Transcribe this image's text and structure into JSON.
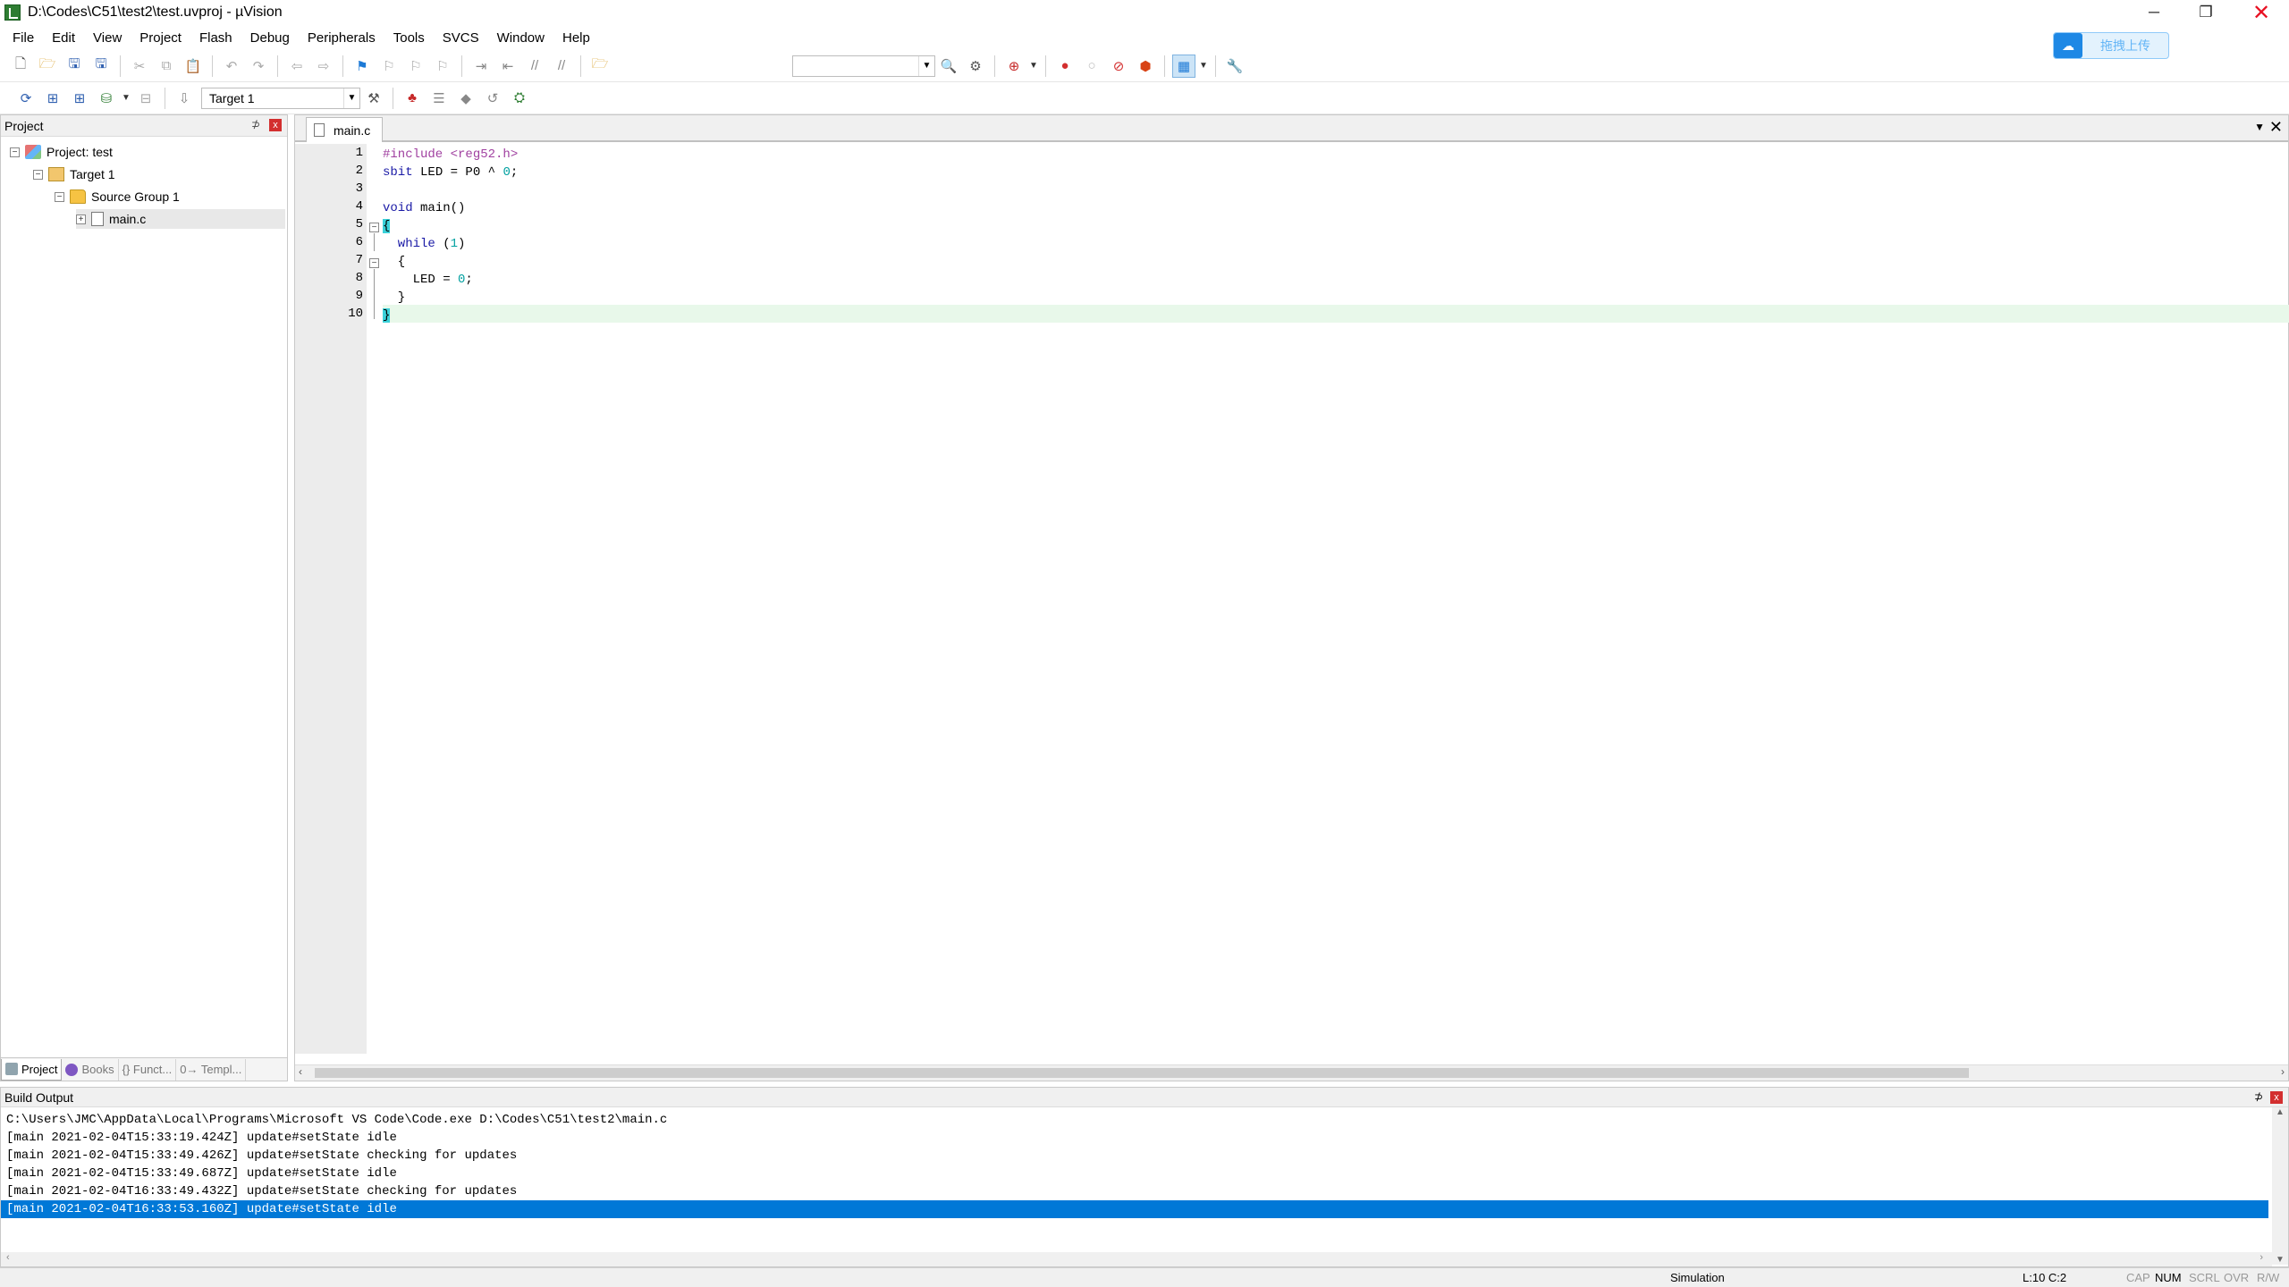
{
  "window": {
    "title": "D:\\Codes\\C51\\test2\\test.uvproj - µVision",
    "minimize_glyph": "─",
    "restore_glyph": "❐",
    "close_glyph": "✕"
  },
  "cloud_widget": {
    "label": "拖拽上传",
    "icon": "cloud-icon"
  },
  "menu": [
    "File",
    "Edit",
    "View",
    "Project",
    "Flash",
    "Debug",
    "Peripherals",
    "Tools",
    "SVCS",
    "Window",
    "Help"
  ],
  "toolbar2": {
    "target_label": "Target 1"
  },
  "project_panel": {
    "header": "Project",
    "pin": "⊅",
    "close": "x",
    "tree": {
      "project": "Project: test",
      "target": "Target 1",
      "group": "Source Group 1",
      "file": "main.c"
    },
    "tabs": [
      "Project",
      "Books",
      "{} Funct...",
      "0→ Templ..."
    ]
  },
  "editor": {
    "tab": "main.c",
    "dropdown": "▼",
    "close": "✕",
    "line_numbers": [
      "1",
      "2",
      "3",
      "4",
      "5",
      "6",
      "7",
      "8",
      "9",
      "10"
    ],
    "code": {
      "l1_pre": "#include",
      "l1_hdr": " <reg52.h>",
      "l2_kw": "sbit",
      "l2_rest": " LED = P0 ^ ",
      "l2_num": "0",
      "l2_end": ";",
      "l4_kw": "void",
      "l4_rest": " main()",
      "l5": "{",
      "l6_kw": "  while",
      "l6_rest": " (",
      "l6_num": "1",
      "l6_end": ")",
      "l7": "  {",
      "l8_rest": "    LED = ",
      "l8_num": "0",
      "l8_end": ";",
      "l9": "  }",
      "l10": "}"
    },
    "highlighted_line": 10
  },
  "build_output": {
    "header": "Build Output",
    "lines": [
      "C:\\Users\\JMC\\AppData\\Local\\Programs\\Microsoft VS Code\\Code.exe D:\\Codes\\C51\\test2\\main.c",
      "[main 2021-02-04T15:33:19.424Z] update#setState idle",
      "[main 2021-02-04T15:33:49.426Z] update#setState checking for updates",
      "[main 2021-02-04T15:33:49.687Z] update#setState idle",
      "[main 2021-02-04T16:33:49.432Z] update#setState checking for updates",
      "[main 2021-02-04T16:33:53.160Z] update#setState idle"
    ],
    "selected_index": 5
  },
  "status": {
    "mode": "Simulation",
    "position": "L:10 C:2",
    "cap": "CAP",
    "num": "NUM",
    "scrl": "SCRL",
    "ovr": "OVR",
    "rw": "R/W"
  },
  "colors": {
    "selection": "#0078d7",
    "current_line": "#e8f8ea",
    "preprocessor": "#a040a0",
    "keyword": "#1a1aa6",
    "number": "#00a0a0",
    "brace_match": "#3ad1d9"
  }
}
